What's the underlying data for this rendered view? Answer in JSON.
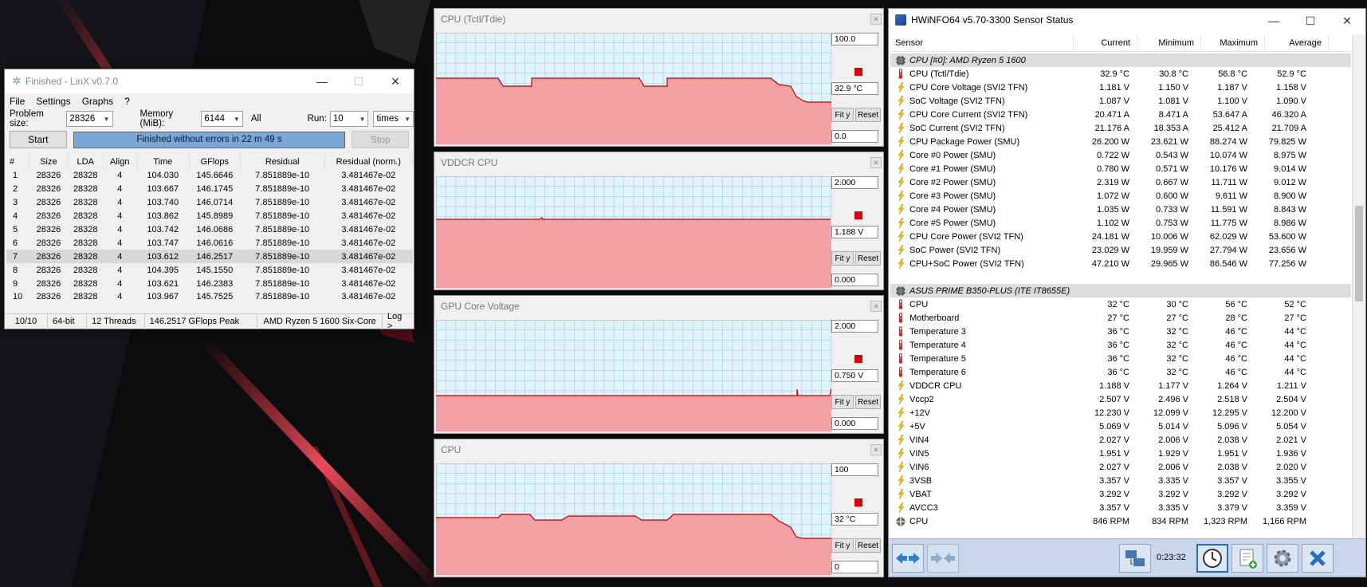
{
  "linx": {
    "title": "Finished - LinX v0.7.0",
    "menu": [
      "File",
      "Settings",
      "Graphs",
      "?"
    ],
    "problem_size_label": "Problem size:",
    "problem_size_value": "28326",
    "memory_label": "Memory (MiB):",
    "memory_value": "6144",
    "all_label": "All",
    "run_label": "Run:",
    "run_value": "10",
    "run_unit": "times",
    "start_label": "Start",
    "stop_label": "Stop",
    "progress_text": "Finished without errors in 22 m 49 s",
    "progress_value": 1.0,
    "columns": [
      "#",
      "Size",
      "LDA",
      "Align",
      "Time",
      "GFlops",
      "Residual",
      "Residual (norm.)"
    ],
    "rows": [
      [
        "1",
        "28326",
        "28328",
        "4",
        "104.030",
        "145.6646",
        "7.851889e-10",
        "3.481467e-02"
      ],
      [
        "2",
        "28326",
        "28328",
        "4",
        "103.667",
        "146.1745",
        "7.851889e-10",
        "3.481467e-02"
      ],
      [
        "3",
        "28326",
        "28328",
        "4",
        "103.740",
        "146.0714",
        "7.851889e-10",
        "3.481467e-02"
      ],
      [
        "4",
        "28326",
        "28328",
        "4",
        "103.862",
        "145.8989",
        "7.851889e-10",
        "3.481467e-02"
      ],
      [
        "5",
        "28326",
        "28328",
        "4",
        "103.742",
        "146.0686",
        "7.851889e-10",
        "3.481467e-02"
      ],
      [
        "6",
        "28326",
        "28328",
        "4",
        "103.747",
        "146.0616",
        "7.851889e-10",
        "3.481467e-02"
      ],
      [
        "7",
        "28326",
        "28328",
        "4",
        "103.612",
        "146.2517",
        "7.851889e-10",
        "3.481467e-02"
      ],
      [
        "8",
        "28326",
        "28328",
        "4",
        "104.395",
        "145.1550",
        "7.851889e-10",
        "3.481467e-02"
      ],
      [
        "9",
        "28326",
        "28328",
        "4",
        "103.621",
        "146.2383",
        "7.851889e-10",
        "3.481467e-02"
      ],
      [
        "10",
        "28326",
        "28328",
        "4",
        "103.967",
        "145.7525",
        "7.851889e-10",
        "3.481467e-02"
      ]
    ],
    "status": [
      "10/10",
      "64-bit",
      "12 Threads",
      "146.2517 GFlops Peak",
      "AMD Ryzen 5 1600 Six-Core",
      "Log >"
    ]
  },
  "graphs": [
    {
      "title": "CPU (Tctl/Tdie)",
      "max": "100.0",
      "current": "32.9 °C",
      "min": "0.0",
      "fit": "Fit y",
      "reset": "Reset",
      "levels": [
        0.5,
        0.5,
        0.5,
        0.5,
        0.5,
        0.5,
        0.5,
        0.5,
        0.5,
        0.5,
        0.5,
        0.5,
        0.5,
        0.5,
        0.5,
        0.5,
        0.5,
        0.5,
        0.5,
        0.5,
        0.5,
        0.5,
        0.5,
        0.5,
        0.5,
        0.5,
        0.5,
        0.5,
        0.5,
        0.5,
        0.5,
        0.5,
        0.5,
        0.5,
        0.5,
        0.5,
        0.5,
        0.5,
        0.5,
        0.5,
        0.5,
        0.5,
        0.5,
        0.5,
        0.5,
        0.5,
        0.5,
        0.5,
        0.5,
        0.5,
        0.5,
        0.5,
        0.5,
        0.5,
        0.5,
        0.5,
        0.5,
        0.5,
        0.5,
        0.5,
        0.5,
        0.5,
        0.5,
        0.5,
        0.5,
        0.5,
        0.5,
        0.5,
        0.5,
        0.5,
        0.5,
        0.5,
        0.5,
        0.5,
        0.5,
        0.5,
        0.5,
        0.5,
        0.5,
        0.5,
        0.5,
        0.5,
        0.5,
        0.5,
        0.5,
        0.5,
        0.5,
        0.5,
        0.5,
        0.5,
        0.5,
        0.5,
        0.5,
        0.5,
        0.5,
        0.5,
        0.5,
        0.5,
        0.5,
        0.5,
        0.5,
        0.5,
        0.5,
        0.5,
        0.5,
        0.5,
        0.5,
        0.5,
        0.5,
        0.5,
        0.5,
        0.5,
        0.5,
        0.5,
        0.5,
        0.5,
        0.5,
        0.5,
        0.5,
        0.5
      ]
    },
    {
      "title": "VDDCR CPU",
      "max": "2.000",
      "current": "1.188 V",
      "min": "0.000",
      "fit": "Fit y",
      "reset": "Reset",
      "levels": [
        0.59,
        0.59,
        0.59,
        0.59,
        0.59,
        0.59,
        0.59,
        0.59,
        0.59,
        0.59
      ]
    },
    {
      "title": "GPU Core Voltage",
      "max": "2.000",
      "current": "0.750 V",
      "min": "0.000",
      "fit": "Fit y",
      "reset": "Reset",
      "levels": [
        0.375,
        0.375,
        0.375,
        0.375,
        0.375,
        0.375,
        0.375,
        0.375,
        0.375,
        0.375
      ]
    },
    {
      "title": "CPU",
      "max": "100",
      "current": "32 °C",
      "min": "0",
      "fit": "Fit y",
      "reset": "Reset",
      "levels": [
        0.5,
        0.5,
        0.5,
        0.5,
        0.5
      ]
    }
  ],
  "hwinfo": {
    "title": "HWiNFO64 v5.70-3300 Sensor Status",
    "columns": [
      "Sensor",
      "Current",
      "Minimum",
      "Maximum",
      "Average"
    ],
    "rows": [
      {
        "type": "group",
        "name": "CPU [#0]: AMD Ryzen 5 1600"
      },
      {
        "icon": "thermometer",
        "name": "CPU (Tctl/Tdie)",
        "v": [
          "32.9 °C",
          "30.8 °C",
          "56.8 °C",
          "52.9 °C"
        ]
      },
      {
        "icon": "bolt",
        "name": "CPU Core Voltage (SVI2 TFN)",
        "v": [
          "1.181 V",
          "1.150 V",
          "1.187 V",
          "1.158 V"
        ]
      },
      {
        "icon": "bolt",
        "name": "SoC Voltage (SVI2 TFN)",
        "v": [
          "1.087 V",
          "1.081 V",
          "1.100 V",
          "1.090 V"
        ]
      },
      {
        "icon": "bolt",
        "name": "CPU Core Current (SVI2 TFN)",
        "v": [
          "20.471 A",
          "8.471 A",
          "53.647 A",
          "46.320 A"
        ]
      },
      {
        "icon": "bolt",
        "name": "SoC Current (SVI2 TFN)",
        "v": [
          "21.176 A",
          "18.353 A",
          "25.412 A",
          "21.709 A"
        ]
      },
      {
        "icon": "bolt",
        "name": "CPU Package Power (SMU)",
        "v": [
          "26.200 W",
          "23.621 W",
          "88.274 W",
          "79.825 W"
        ]
      },
      {
        "icon": "bolt",
        "name": "Core #0 Power (SMU)",
        "v": [
          "0.722 W",
          "0.543 W",
          "10.074 W",
          "8.975 W"
        ]
      },
      {
        "icon": "bolt",
        "name": "Core #1 Power (SMU)",
        "v": [
          "0.780 W",
          "0.571 W",
          "10.176 W",
          "9.014 W"
        ]
      },
      {
        "icon": "bolt",
        "name": "Core #2 Power (SMU)",
        "v": [
          "2.319 W",
          "0.667 W",
          "11.711 W",
          "9.012 W"
        ]
      },
      {
        "icon": "bolt",
        "name": "Core #3 Power (SMU)",
        "v": [
          "1.072 W",
          "0.600 W",
          "9.611 W",
          "8.900 W"
        ]
      },
      {
        "icon": "bolt",
        "name": "Core #4 Power (SMU)",
        "v": [
          "1.035 W",
          "0.733 W",
          "11.591 W",
          "8.843 W"
        ]
      },
      {
        "icon": "bolt",
        "name": "Core #5 Power (SMU)",
        "v": [
          "1.102 W",
          "0.753 W",
          "11.775 W",
          "8.986 W"
        ]
      },
      {
        "icon": "bolt",
        "name": "CPU Core Power (SVI2 TFN)",
        "v": [
          "24.181 W",
          "10.006 W",
          "62.029 W",
          "53.600 W"
        ]
      },
      {
        "icon": "bolt",
        "name": "SoC Power (SVI2 TFN)",
        "v": [
          "23.029 W",
          "19.959 W",
          "27.794 W",
          "23.656 W"
        ]
      },
      {
        "icon": "bolt",
        "name": "CPU+SoC Power (SVI2 TFN)",
        "v": [
          "47.210 W",
          "29.965 W",
          "86.546 W",
          "77.256 W"
        ]
      },
      {
        "type": "blank"
      },
      {
        "type": "group",
        "name": "ASUS PRIME B350-PLUS (ITE IT8655E)"
      },
      {
        "icon": "thermometer",
        "name": "CPU",
        "v": [
          "32 °C",
          "30 °C",
          "56 °C",
          "52 °C"
        ]
      },
      {
        "icon": "thermometer",
        "name": "Motherboard",
        "v": [
          "27 °C",
          "27 °C",
          "28 °C",
          "27 °C"
        ]
      },
      {
        "icon": "thermometer",
        "name": "Temperature 3",
        "v": [
          "36 °C",
          "32 °C",
          "46 °C",
          "44 °C"
        ]
      },
      {
        "icon": "thermometer",
        "name": "Temperature 4",
        "v": [
          "36 °C",
          "32 °C",
          "46 °C",
          "44 °C"
        ]
      },
      {
        "icon": "thermometer",
        "name": "Temperature 5",
        "v": [
          "36 °C",
          "32 °C",
          "46 °C",
          "44 °C"
        ]
      },
      {
        "icon": "thermometer",
        "name": "Temperature 6",
        "v": [
          "36 °C",
          "32 °C",
          "46 °C",
          "44 °C"
        ]
      },
      {
        "icon": "bolt",
        "name": "VDDCR CPU",
        "v": [
          "1.188 V",
          "1.177 V",
          "1.264 V",
          "1.211 V"
        ]
      },
      {
        "icon": "bolt",
        "name": "Vccp2",
        "v": [
          "2.507 V",
          "2.496 V",
          "2.518 V",
          "2.504 V"
        ]
      },
      {
        "icon": "bolt",
        "name": "+12V",
        "v": [
          "12.230 V",
          "12.099 V",
          "12.295 V",
          "12.200 V"
        ]
      },
      {
        "icon": "bolt",
        "name": "+5V",
        "v": [
          "5.069 V",
          "5.014 V",
          "5.096 V",
          "5.054 V"
        ]
      },
      {
        "icon": "bolt",
        "name": "VIN4",
        "v": [
          "2.027 V",
          "2.006 V",
          "2.038 V",
          "2.021 V"
        ]
      },
      {
        "icon": "bolt",
        "name": "VIN5",
        "v": [
          "1.951 V",
          "1.929 V",
          "1.951 V",
          "1.936 V"
        ]
      },
      {
        "icon": "bolt",
        "name": "VIN6",
        "v": [
          "2.027 V",
          "2.006 V",
          "2.038 V",
          "2.020 V"
        ]
      },
      {
        "icon": "bolt",
        "name": "3VSB",
        "v": [
          "3.357 V",
          "3.335 V",
          "3.357 V",
          "3.355 V"
        ]
      },
      {
        "icon": "bolt",
        "name": "VBAT",
        "v": [
          "3.292 V",
          "3.292 V",
          "3.292 V",
          "3.292 V"
        ]
      },
      {
        "icon": "bolt",
        "name": "AVCC3",
        "v": [
          "3.357 V",
          "3.335 V",
          "3.379 V",
          "3.359 V"
        ]
      },
      {
        "icon": "fan",
        "name": "CPU",
        "v": [
          "846 RPM",
          "834 RPM",
          "1,323 RPM",
          "1,166 RPM"
        ]
      }
    ],
    "elapsed": "0:23:32"
  },
  "colors": {
    "graph_bg": "#dff3fb",
    "graph_grid": "#a9c9d8",
    "graph_fill": "#f4a0a4",
    "graph_line": "#c00000",
    "progress": "#7aa6d8"
  }
}
